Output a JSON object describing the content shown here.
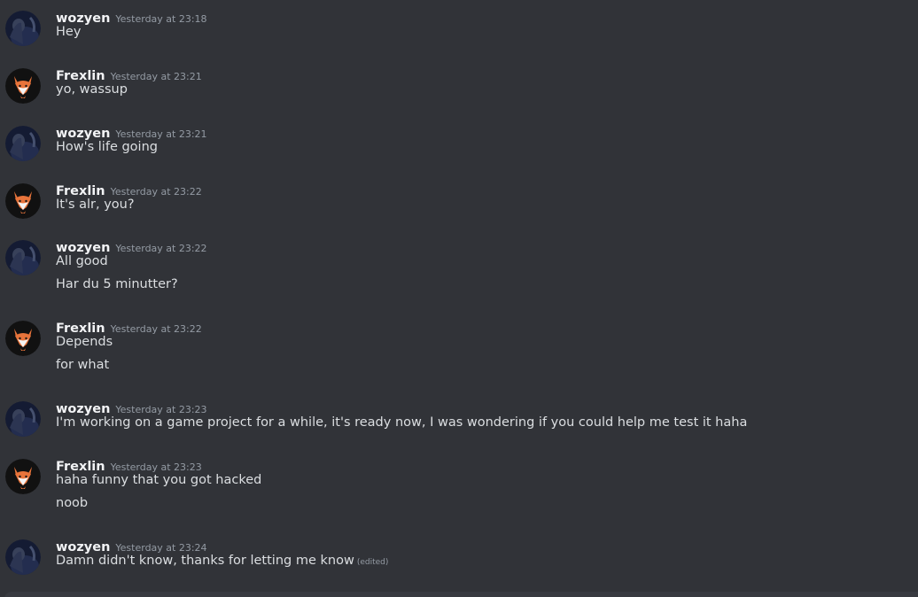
{
  "messages": [
    {
      "author": "wozyen",
      "time": "Yesterday at 23:18",
      "avatar": "wozyen-avatar",
      "lines": [
        "Hey"
      ]
    },
    {
      "author": "Frexlin",
      "time": "Yesterday at 23:21",
      "avatar": "fox-avatar",
      "lines": [
        "yo, wassup"
      ]
    },
    {
      "author": "wozyen",
      "time": "Yesterday at 23:21",
      "avatar": "wozyen-avatar",
      "lines": [
        "How's life going"
      ]
    },
    {
      "author": "Frexlin",
      "time": "Yesterday at 23:22",
      "avatar": "fox-avatar",
      "lines": [
        "It's alr, you?"
      ]
    },
    {
      "author": "wozyen",
      "time": "Yesterday at 23:22",
      "avatar": "wozyen-avatar",
      "lines": [
        "All good",
        "Har du 5 minutter?"
      ]
    },
    {
      "author": "Frexlin",
      "time": "Yesterday at 23:22",
      "avatar": "fox-avatar",
      "lines": [
        "Depends",
        "for what"
      ]
    },
    {
      "author": "wozyen",
      "time": "Yesterday at 23:23",
      "avatar": "wozyen-avatar",
      "lines": [
        "I'm working on a game project for a while, it's ready now, I was wondering if you could help me test it haha"
      ]
    },
    {
      "author": "Frexlin",
      "time": "Yesterday at 23:23",
      "avatar": "fox-avatar",
      "lines": [
        "haha funny that you got hacked",
        "noob"
      ]
    },
    {
      "author": "wozyen",
      "time": "Yesterday at 23:24",
      "avatar": "wozyen-avatar",
      "lines": [
        "Damn didn't know, thanks for letting me know"
      ],
      "edited": "(edited)"
    }
  ]
}
